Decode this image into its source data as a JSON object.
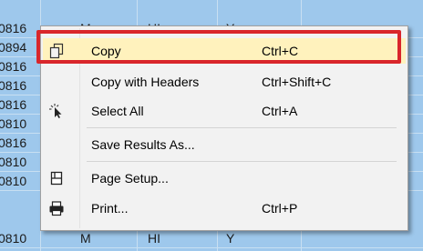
{
  "results_grid": {
    "rows": [
      {
        "id": "0816",
        "c2": "M",
        "c3": "HI",
        "c4": "Y"
      },
      {
        "id": "0894",
        "c2": "",
        "c3": "",
        "c4": ""
      },
      {
        "id": "0816",
        "c2": "",
        "c3": "",
        "c4": ""
      },
      {
        "id": "0816",
        "c2": "",
        "c3": "",
        "c4": ""
      },
      {
        "id": "0816",
        "c2": "",
        "c3": "",
        "c4": ""
      },
      {
        "id": "0810",
        "c2": "",
        "c3": "",
        "c4": ""
      },
      {
        "id": "0816",
        "c2": "",
        "c3": "",
        "c4": ""
      },
      {
        "id": "0810",
        "c2": "",
        "c3": "",
        "c4": ""
      },
      {
        "id": "0810",
        "c2": "",
        "c3": "",
        "c4": ""
      },
      {
        "id": "0810",
        "c2": "M",
        "c3": "HI",
        "c4": "Y"
      }
    ]
  },
  "context_menu": {
    "items": [
      {
        "label": "Copy",
        "shortcut": "Ctrl+C",
        "icon": "copy-icon"
      },
      {
        "label": "Copy with Headers",
        "shortcut": "Ctrl+Shift+C",
        "icon": ""
      },
      {
        "label": "Select All",
        "shortcut": "Ctrl+A",
        "icon": "select-all-icon"
      },
      {
        "label": "Save Results As...",
        "shortcut": "",
        "icon": ""
      },
      {
        "label": "Page Setup...",
        "shortcut": "",
        "icon": "page-setup-icon"
      },
      {
        "label": "Print...",
        "shortcut": "Ctrl+P",
        "icon": "printer-icon"
      }
    ],
    "highlight_color": "#fff2bd",
    "callout_border_color": "#d9262b"
  }
}
